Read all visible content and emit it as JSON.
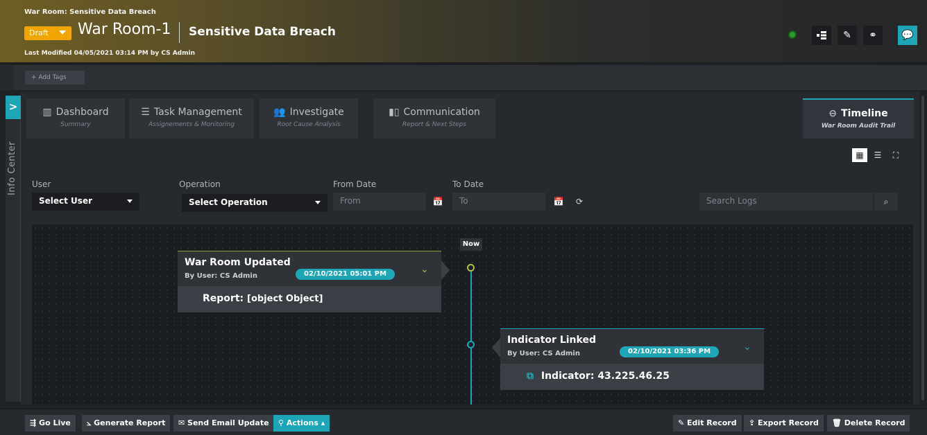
{
  "header": {
    "breadcrumb": "War Room: Sensitive Data Breach",
    "status": "Draft",
    "title": "War Room-1",
    "subtitle": "Sensitive Data Breach",
    "last_modified": "Last Modified 04/05/2021 03:14 PM by CS Admin",
    "brand_color": "#1fa6b6",
    "draft_color": "#f0a500"
  },
  "tags": {
    "add_label": "+ Add Tags"
  },
  "info_center": {
    "toggle": ">",
    "label": "Info Center"
  },
  "tabs": [
    {
      "label": "Dashboard",
      "sub": "Summary",
      "icon": "bar-chart-icon"
    },
    {
      "label": "Task Management",
      "sub": "Assignements & Monitoring",
      "icon": "list-icon"
    },
    {
      "label": "Investigate",
      "sub": "Root Cause Analysis",
      "icon": "users-icon"
    },
    {
      "label": "Communication",
      "sub": "Report & Next Steps",
      "icon": "chart-icon"
    },
    {
      "label": "Timeline",
      "sub": "War Room Audit Trail",
      "icon": "timeline-icon",
      "active": true
    }
  ],
  "filters": {
    "user_label": "User",
    "user_value": "Select User",
    "operation_label": "Operation",
    "operation_value": "Select Operation",
    "from_label": "From Date",
    "from_placeholder": "From",
    "to_label": "To Date",
    "to_placeholder": "To",
    "search_placeholder": "Search Logs"
  },
  "timeline": {
    "now_label": "Now",
    "events": [
      {
        "title": "War Room Updated",
        "user": "By User: CS Admin",
        "date": "02/10/2021 05:01 PM",
        "body_key": "Report:",
        "body_value": "[object Object]"
      },
      {
        "title": "Indicator Linked",
        "user": "By User: CS Admin",
        "date": "02/10/2021 03:36 PM",
        "body_key": "Indicator:",
        "body_value": "43.225.46.25"
      }
    ]
  },
  "bottom": {
    "go_live": "Go Live",
    "generate_report": "Generate Report",
    "send_email": "Send Email Update",
    "actions": "Actions",
    "edit_record": "Edit Record",
    "export_record": "Export Record",
    "delete_record": "Delete Record"
  }
}
